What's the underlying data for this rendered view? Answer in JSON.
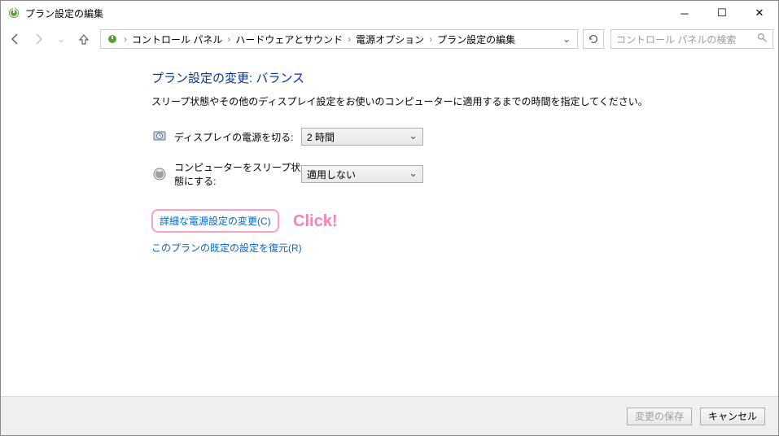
{
  "window": {
    "title": "プラン設定の編集"
  },
  "breadcrumb": {
    "items": [
      "コントロール パネル",
      "ハードウェアとサウンド",
      "電源オプション",
      "プラン設定の編集"
    ]
  },
  "search": {
    "placeholder": "コントロール パネルの検索"
  },
  "heading": "プラン設定の変更: バランス",
  "instruction": "スリープ状態やその他のディスプレイ設定をお使いのコンピューターに適用するまでの時間を指定してください。",
  "settings": {
    "display_off": {
      "label": "ディスプレイの電源を切る:",
      "value": "2 時間"
    },
    "sleep": {
      "label": "コンピューターをスリープ状態にする:",
      "value": "適用しない"
    }
  },
  "links": {
    "advanced": "詳細な電源設定の変更(C)",
    "restore": "このプランの既定の設定を復元(R)"
  },
  "annotation": "Click!",
  "buttons": {
    "save": "変更の保存",
    "cancel": "キャンセル"
  }
}
